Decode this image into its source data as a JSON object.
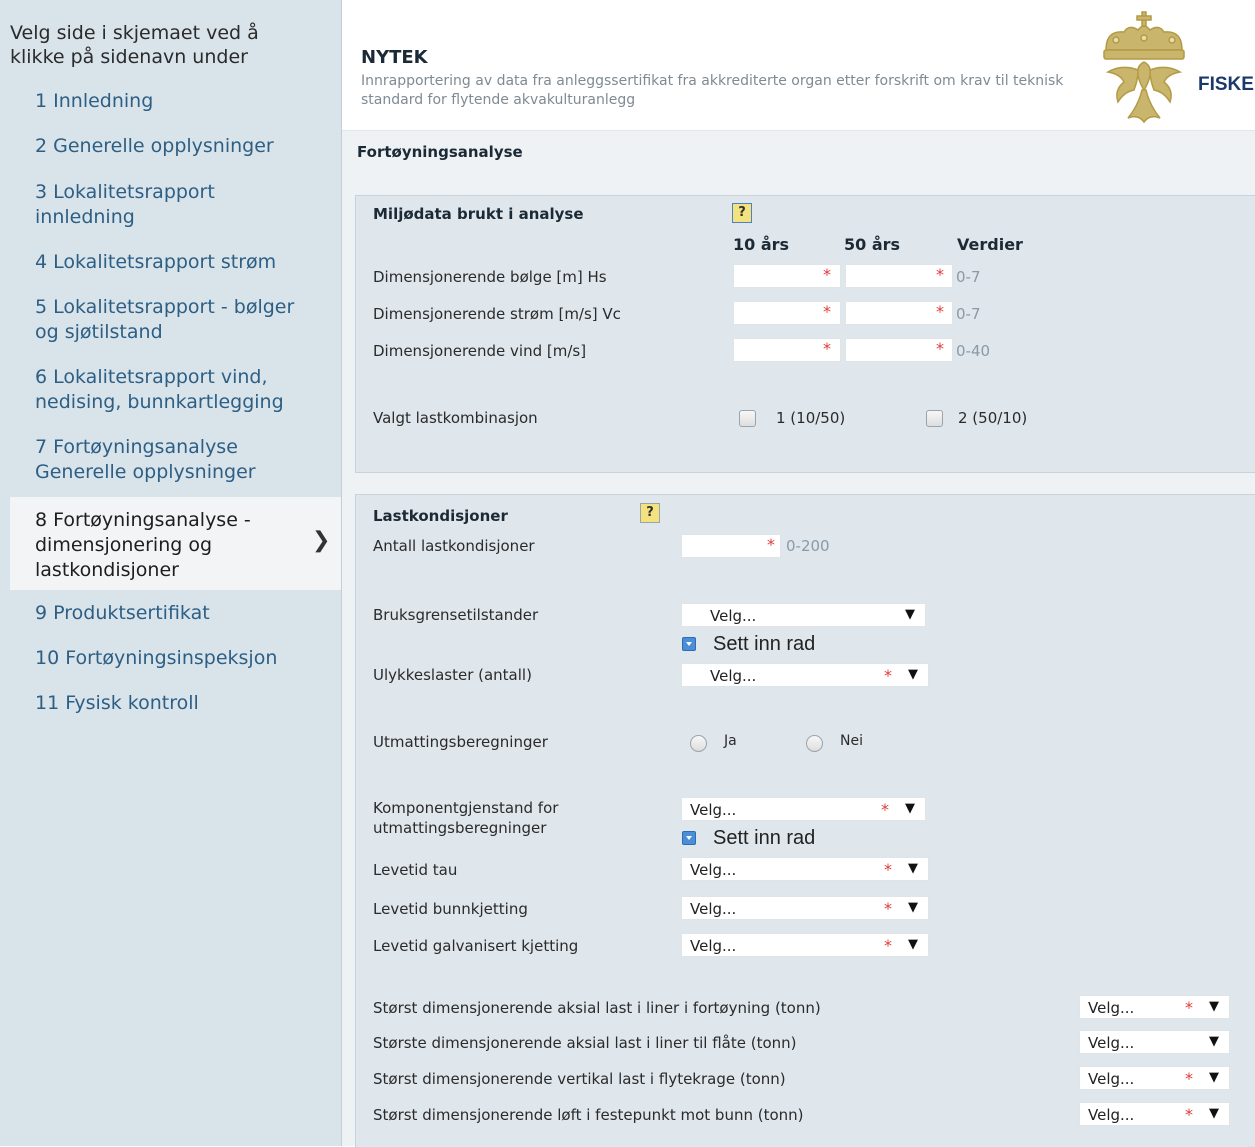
{
  "sidebar": {
    "intro": "Velg side i skjemaet ved å klikke på sidenavn under",
    "items": [
      {
        "label": "1 Innledning"
      },
      {
        "label": "2 Generelle opplysninger"
      },
      {
        "label": "3 Lokalitetsrapport innledning"
      },
      {
        "label": "4 Lokalitetsrapport strøm"
      },
      {
        "label": "5 Lokalitetsrapport - bølger og sjøtilstand"
      },
      {
        "label": "6 Lokalitetsrapport vind, nedising, bunnkartlegging"
      },
      {
        "label": "7 Fortøyningsanalyse Generelle opplysninger"
      },
      {
        "label": "8 Fortøyningsanalyse - dimensjonering og lastkondisjoner"
      },
      {
        "label": "9 Produktsertifikat"
      },
      {
        "label": "10 Fortøyningsinspeksjon"
      },
      {
        "label": "11 Fysisk kontroll"
      }
    ]
  },
  "header": {
    "title": "NYTEK",
    "description": "Innrapportering av data fra anleggssertifikat fra akkrediterte organ etter forskrift om krav til teknisk standard for flytende akvakulturanlegg",
    "logo_text": "FISKERID"
  },
  "page_title": "Fortøyningsanalyse",
  "miljodata": {
    "title": "Miljødata brukt i analyse",
    "help": "?",
    "col_10": "10 års",
    "col_50": "50 års",
    "col_values": "Verdier",
    "rows": [
      {
        "label": "Dimensjonerende bølge [m] Hs",
        "range": "0-7"
      },
      {
        "label": "Dimensjonerende strøm [m/s] Vc",
        "range": "0-7"
      },
      {
        "label": "Dimensjonerende vind [m/s]",
        "range": "0-40"
      }
    ],
    "required": "*",
    "lastkombinasjon": {
      "label": "Valgt lastkombinasjon",
      "option1": "1 (10/50)",
      "option2": "2 (50/10)"
    }
  },
  "lastkondisjoner": {
    "title": "Lastkondisjoner",
    "help": "?",
    "antall_label": "Antall lastkondisjoner",
    "antall_range": "0-200",
    "bruksgrense_label": "Bruksgrensetilstander",
    "sett_inn_rad": "Sett inn rad",
    "ulykkeslaster_label": "Ulykkeslaster (antall)",
    "utmatting_label": "Utmattingsberegninger",
    "radio_ja": "Ja",
    "radio_nei": "Nei",
    "komponent_label_1": "Komponentgjenstand for",
    "komponent_label_2": "utmattingsberegninger",
    "levetid_tau_label": "Levetid tau",
    "levetid_bunn_label": "Levetid bunnkjetting",
    "levetid_galv_label": "Levetid galvanisert kjetting",
    "last_fortoyning_label": "Størst dimensjonerende aksial last i liner i fortøyning (tonn)",
    "last_flate_label": "Største dimensjonerende aksial last i liner til flåte (tonn)",
    "last_flytekrage_label": "Størst dimensjonerende vertikal last i flytekrage (tonn)",
    "loft_bunn_label": "Størst dimensjonerende løft i festepunkt mot bunn (tonn)",
    "select_placeholder": "Velg...",
    "required": "*"
  }
}
